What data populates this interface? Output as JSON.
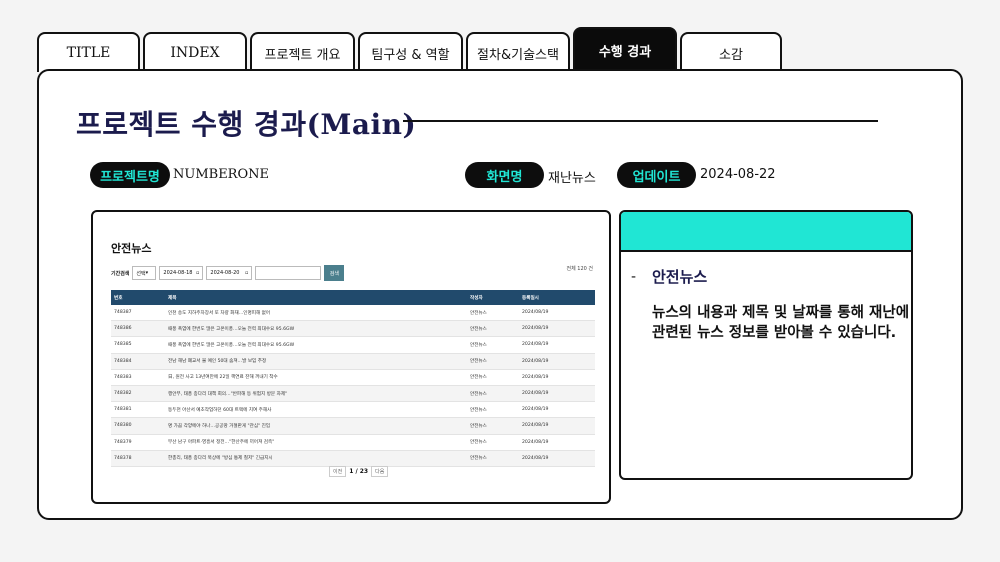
{
  "tabs": [
    {
      "label": "TITLE"
    },
    {
      "label": "INDEX"
    },
    {
      "label": "프로젝트 개요"
    },
    {
      "label": "팀구성 & 역할"
    },
    {
      "label": "절차&기술스택"
    },
    {
      "label": "수행 경과"
    },
    {
      "label": "소감"
    }
  ],
  "active_tab": "수행 경과",
  "page_title": "프로젝트 수행 경과(Main)",
  "meta": {
    "project_label": "프로젝트명",
    "project_value": "NUMBERONE",
    "screen_label": "화면명",
    "screen_value": "재난뉴스",
    "update_label": "업데이트",
    "update_value": "2024-08-22"
  },
  "screenshot": {
    "title": "안전뉴스",
    "filter_label": "기간검색",
    "select_value": "선택",
    "date_from": "2024-08-18",
    "date_to": "2024-08-20",
    "search_button": "검색",
    "total_count": "전체 120 건",
    "columns": [
      "번호",
      "제목",
      "작성자",
      "등록일시"
    ],
    "rows": [
      [
        "748387",
        "인천 송도 지하주차장서 또 차량 화재…인명피해 없어",
        "안전뉴스",
        "2024/08/19"
      ],
      [
        "748386",
        "때풍 폭염에 한번도 많은 고온이풍…오늘 전력 최대수요 95.6GW",
        "안전뉴스",
        "2024/08/19"
      ],
      [
        "748385",
        "때풍 폭염에 한번도 많은 고온이풍…오늘 전력 최대수요 95.6GW",
        "안전뉴스",
        "2024/08/19"
      ],
      [
        "748384",
        "전남 해남 폐교서 불 예인 50대 숨져…발 보임 추정",
        "안전뉴스",
        "2024/08/19"
      ],
      [
        "748383",
        "日, 원전 사고 13년여만에 22일 핵연료 잔해 꺼내기 착수",
        "안전뉴스",
        "2024/08/19"
      ],
      [
        "748382",
        "행안부, 태풍 종다리 대책 회의…\"반파해 등 위험지 방문 자제\"",
        "안전뉴스",
        "2024/08/19"
      ],
      [
        "748381",
        "동두천 아산서 예초작업하던 60대 트랙에 치여 주해사",
        "안전뉴스",
        "2024/08/19"
      ],
      [
        "748380",
        "명 가끔 각양에야 하나…공공땅 거절판게 \"관심\" 진입",
        "안전뉴스",
        "2024/08/19"
      ],
      [
        "748379",
        "부산 남구 아파트·영흥서 정전…\"한산주에 끼어져 검측\"",
        "안전뉴스",
        "2024/08/19"
      ],
      [
        "748378",
        "한총리, 태풍 종다리 북상에 \"방심 통제 철저\" 긴급지시",
        "안전뉴스",
        "2024/08/19"
      ]
    ],
    "pager_prev": "이전",
    "pager_current": "1 / 23",
    "pager_next": "다음"
  },
  "description": {
    "bullet": "-",
    "title": "안전뉴스",
    "body": "뉴스의 내용과 제목 및 날짜를 통해 재난에 관련된 뉴스 정보를 받아볼 수 있습니다."
  },
  "colors": {
    "accent": "#20e6d4",
    "title_color": "#1b1b4d",
    "table_header": "#214a6c",
    "dark": "#0d0d0d"
  }
}
